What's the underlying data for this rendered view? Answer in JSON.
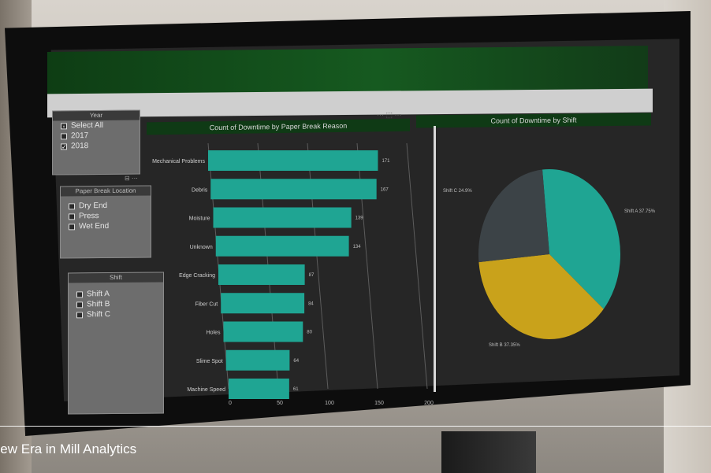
{
  "colors": {
    "teal": "#1fa593",
    "gold": "#c9a21b",
    "slate": "#3c4347",
    "header_green": "#165a20"
  },
  "slicers": {
    "year": {
      "title": "Year",
      "items": [
        {
          "label": "Select All",
          "checked": "partial"
        },
        {
          "label": "2017",
          "checked": "no"
        },
        {
          "label": "2018",
          "checked": "yes"
        }
      ]
    },
    "location": {
      "title": "Paper Break Location",
      "items": [
        {
          "label": "Dry End",
          "checked": "no"
        },
        {
          "label": "Press",
          "checked": "no"
        },
        {
          "label": "Wet End",
          "checked": "no"
        }
      ]
    },
    "shift": {
      "title": "Shift",
      "items": [
        {
          "label": "Shift A",
          "checked": "no"
        },
        {
          "label": "Shift B",
          "checked": "no"
        },
        {
          "label": "Shift C",
          "checked": "no"
        }
      ]
    }
  },
  "chart_data": [
    {
      "type": "bar",
      "orientation": "horizontal",
      "title": "Count of Downtime by Paper Break Reason",
      "categories": [
        "Mechanical Problems",
        "Debris",
        "Moisture",
        "Unknown",
        "Edge Cracking",
        "Fiber Cut",
        "Holes",
        "Slime Spot",
        "Machine Speed"
      ],
      "values": [
        171,
        167,
        139,
        134,
        87,
        84,
        80,
        64,
        61
      ],
      "xticks": [
        "0",
        "50",
        "100",
        "150",
        "200"
      ],
      "xlim": [
        0,
        200
      ],
      "grid": true
    },
    {
      "type": "pie",
      "title": "Count of Downtime by Shift",
      "slices": [
        {
          "label": "Shift A 37.75%",
          "value": 37.75,
          "color": "#1fa593"
        },
        {
          "label": "Shift B 37.35%",
          "value": 37.35,
          "color": "#c9a21b"
        },
        {
          "label": "Shift C 24.9%",
          "value": 24.9,
          "color": "#3c4347"
        }
      ]
    }
  ],
  "caption": "New Era in Mill Analytics"
}
